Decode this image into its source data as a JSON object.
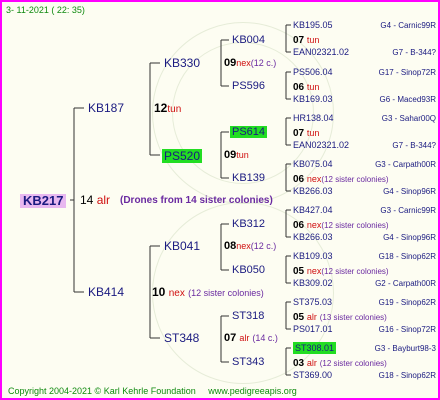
{
  "timestamp": "3- 11-2021 ( 22: 35)",
  "footer": {
    "copyright": "Copyright 2004-2021 © Karl Kehrle Foundation",
    "url": "www.pedigreeapis.org"
  },
  "root": {
    "name": "KB217",
    "number": "14",
    "code": "alr",
    "note": "(Drones from 14 sister colonies)"
  },
  "g1": [
    {
      "name": "KB187",
      "number": "12",
      "code": "tun"
    },
    {
      "name": "KB414",
      "number": "10",
      "code": "nex",
      "note": "(12 sister colonies)"
    }
  ],
  "g2": [
    {
      "name": "KB330",
      "number": "09",
      "code": "nex",
      "note": "(12 c.)"
    },
    {
      "name": "PS520",
      "number": "09",
      "code": "tun"
    },
    {
      "name": "KB041",
      "number": "08",
      "code": "nex",
      "note": "(12 c.)"
    },
    {
      "name": "ST348",
      "number": "07",
      "code": "alr",
      "note": "(14 c.)"
    }
  ],
  "g3": [
    {
      "name": "KB004",
      "number": "07",
      "code": "tun"
    },
    {
      "name": "PS596",
      "number": "06",
      "code": "tun"
    },
    {
      "name": "PS614",
      "number": "07",
      "code": "tun"
    },
    {
      "name": "KB139",
      "number": "06",
      "code": "nex",
      "note": "(12 sister colonies)"
    },
    {
      "name": "KB312",
      "number": "06",
      "code": "nex",
      "note": "(12 sister colonies)"
    },
    {
      "name": "KB050",
      "number": "05",
      "code": "nex",
      "note": "(12 sister colonies)"
    },
    {
      "name": "ST318",
      "number": "05",
      "code": "alr",
      "note": "(13 sister colonies)"
    },
    {
      "name": "ST343",
      "number": "03",
      "code": "alr",
      "note": "(12 sister colonies)"
    }
  ],
  "g4": [
    {
      "name": "KB195.05",
      "ref": "G4 - Carnic99R"
    },
    {
      "name": "EAN02321.02",
      "ref": "G7 - B-344?"
    },
    {
      "name": "PS506.04",
      "ref": "G17 - Sinop72R"
    },
    {
      "name": "KB169.03",
      "ref": "G6 - Maced93R"
    },
    {
      "name": "HR138.04",
      "ref": "G3 - Sahar00Q"
    },
    {
      "name": "EAN02321.02",
      "ref": "G7 - B-344?"
    },
    {
      "name": "KB075.04",
      "ref": "G3 - Carpath00R"
    },
    {
      "name": "KB266.03",
      "ref": "G4 - Sinop96R"
    },
    {
      "name": "KB427.04",
      "ref": "G3 - Carnic99R"
    },
    {
      "name": "KB266.03",
      "ref": "G4 - Sinop96R"
    },
    {
      "name": "KB109.03",
      "ref": "G18 - Sinop62R"
    },
    {
      "name": "KB309.02",
      "ref": "G2 - Carpath00R"
    },
    {
      "name": "ST375.03",
      "ref": "G19 - Sinop62R"
    },
    {
      "name": "PS017.01",
      "ref": "G16 - Sinop72R"
    },
    {
      "name": "ST308.01",
      "ref": "G3 - Bayburt98-3"
    },
    {
      "name": "ST369.00",
      "ref": "G18 - Sinop62R"
    }
  ],
  "colors": {
    "frame": "#ff00ff",
    "background": "#fdfdf2",
    "highlight": "#22dd22",
    "root_highlight": "#e8b8f0",
    "footer_text": "#108a10",
    "code_text": "#d01010",
    "note_text": "#6a2aa0",
    "ref_text": "#1a1a80"
  }
}
